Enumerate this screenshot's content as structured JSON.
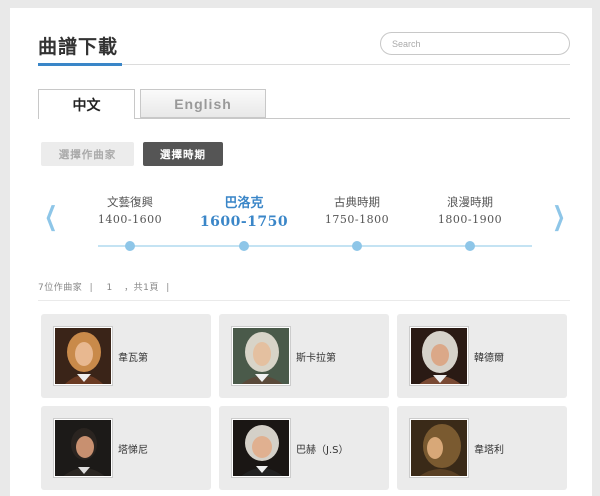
{
  "header": {
    "title": "曲譜下載",
    "search_placeholder": "Search"
  },
  "tabs": [
    {
      "label": "中文",
      "active": true
    },
    {
      "label": "English",
      "active": false
    }
  ],
  "filters": [
    {
      "label": "選擇作曲家",
      "active": false
    },
    {
      "label": "選擇時期",
      "active": true
    }
  ],
  "timeline": {
    "periods": [
      {
        "name": "文藝復興",
        "years": "1400-1600",
        "active": false
      },
      {
        "name": "巴洛克",
        "years": "1600-1750",
        "active": true
      },
      {
        "name": "古典時期",
        "years": "1750-1800",
        "active": false
      },
      {
        "name": "浪漫時期",
        "years": "1800-1900",
        "active": false
      }
    ],
    "prev_icon": "chevron-left-icon",
    "next_icon": "chevron-right-icon",
    "accent_color": "#3a86c8",
    "line_color": "#c4e3f3"
  },
  "pagination": {
    "count_text": "7位作曲家",
    "sep1": "|",
    "page": "1",
    "total_text": "，共1頁",
    "sep2": "|"
  },
  "composers": [
    {
      "name": "韋瓦第"
    },
    {
      "name": "斯卡拉第"
    },
    {
      "name": "韓德爾"
    },
    {
      "name": "塔悌尼"
    },
    {
      "name": "巴赫（J.S）"
    },
    {
      "name": "韋塔利"
    }
  ]
}
